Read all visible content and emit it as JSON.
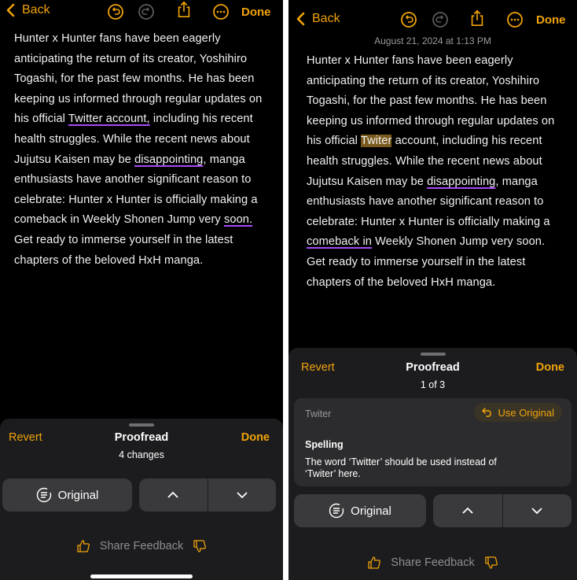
{
  "colors": {
    "accent": "#f0a30a",
    "underline": "#a64bf4",
    "highlight": "#7a5a1e",
    "sheet": "#1c1c1e",
    "button": "#3a3a3c"
  },
  "left": {
    "toolbar": {
      "back_label": "Back",
      "done_label": "Done"
    },
    "note_lines": [
      "Hunter x Hunter fans have been eagerly",
      "anticipating the return of its creator, Yoshihiro",
      "Togashi, for the past few months. He has been",
      "keeping us informed through regular updates on"
    ],
    "line5": {
      "pre": "his official ",
      "underlined": "Twitter account,",
      "post": " including his recent"
    },
    "line6": "health struggles. While the recent news about",
    "line7": {
      "pre": "Jujutsu Kaisen may be ",
      "underlined": "disappointing",
      "post": ", manga"
    },
    "line8": "enthusiasts have another significant reason to",
    "line9": "celebrate: Hunter x Hunter is officially making a",
    "line10": {
      "pre": "comeback in Weekly Shonen Jump very ",
      "underlined": "soon."
    },
    "line11": "Get ready to immerse yourself in the latest",
    "line12": "chapters of the beloved HxH manga.",
    "sheet": {
      "revert_label": "Revert",
      "title": "Proofread",
      "subtitle": "4 changes",
      "done_label": "Done",
      "original_label": "Original",
      "feedback_label": "Share Feedback"
    }
  },
  "right": {
    "toolbar": {
      "back_label": "Back",
      "done_label": "Done"
    },
    "timestamp": "August 21, 2024 at 1:13 PM",
    "note_lines": [
      "Hunter x Hunter fans have been eagerly",
      "anticipating the return of its creator, Yoshihiro",
      "Togashi, for the past few months. He has been",
      "keeping us informed through regular updates on"
    ],
    "line5": {
      "pre": "his official ",
      "highlighted": "Twiter",
      "post": " account, including his recent"
    },
    "line6": "health struggles. While the recent news about",
    "line7": {
      "pre": "Jujutsu Kaisen may be ",
      "underlined": "disappointing",
      "post": ", manga"
    },
    "line8": "enthusiasts have another significant reason to",
    "line9": "celebrate: Hunter x Hunter is officially making a",
    "line10": {
      "underlined": "comeback in",
      "post": " Weekly Shonen Jump very soon."
    },
    "line11": "Get ready to immerse yourself in the latest",
    "line12": "chapters of the beloved HxH manga.",
    "sheet": {
      "revert_label": "Revert",
      "title": "Proofread",
      "subtitle": "1 of 3",
      "done_label": "Done",
      "card": {
        "word": "Twiter",
        "use_original_label": "Use Original",
        "type": "Spelling",
        "description": "The word ‘Twitter’ should be used instead of ‘Twiter’ here."
      },
      "original_label": "Original",
      "feedback_label": "Share Feedback"
    }
  }
}
